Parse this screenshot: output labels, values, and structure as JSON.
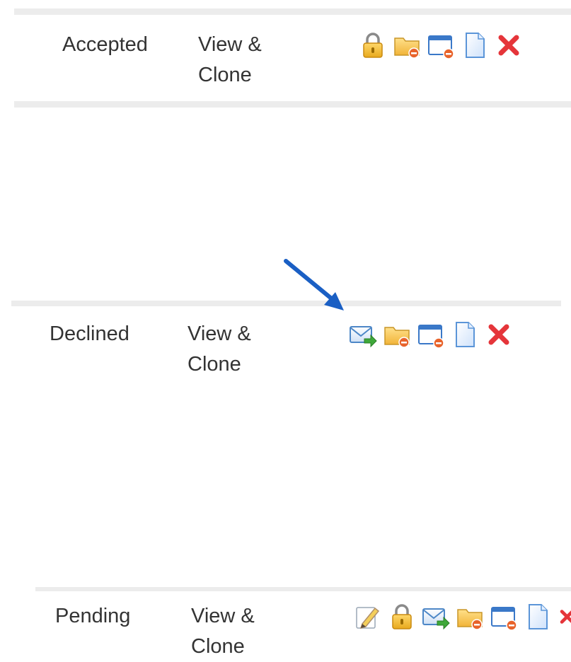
{
  "rows": [
    {
      "status": "Accepted",
      "action": "View & Clone",
      "icons": [
        "lock-icon",
        "folder-icon",
        "window-icon",
        "document-icon",
        "delete-icon"
      ]
    },
    {
      "status": "Declined",
      "action": "View & Clone",
      "icons": [
        "email-forward-icon",
        "folder-icon",
        "window-icon",
        "document-icon",
        "delete-icon"
      ]
    },
    {
      "status": "Pending",
      "action": "View & Clone",
      "icons": [
        "edit-icon",
        "lock-icon",
        "email-forward-icon",
        "folder-icon",
        "window-icon",
        "document-icon",
        "delete-icon"
      ]
    }
  ],
  "colors": {
    "divider": "#ececec",
    "text": "#333333",
    "arrow": "#1a5fc4",
    "delete": "#e5353a",
    "lock": "#f0b429",
    "folder": "#f5c04a",
    "window": "#3a78c8",
    "document": "#5b95d8",
    "email": "#4d87c7",
    "edit": "#b08f6a"
  }
}
